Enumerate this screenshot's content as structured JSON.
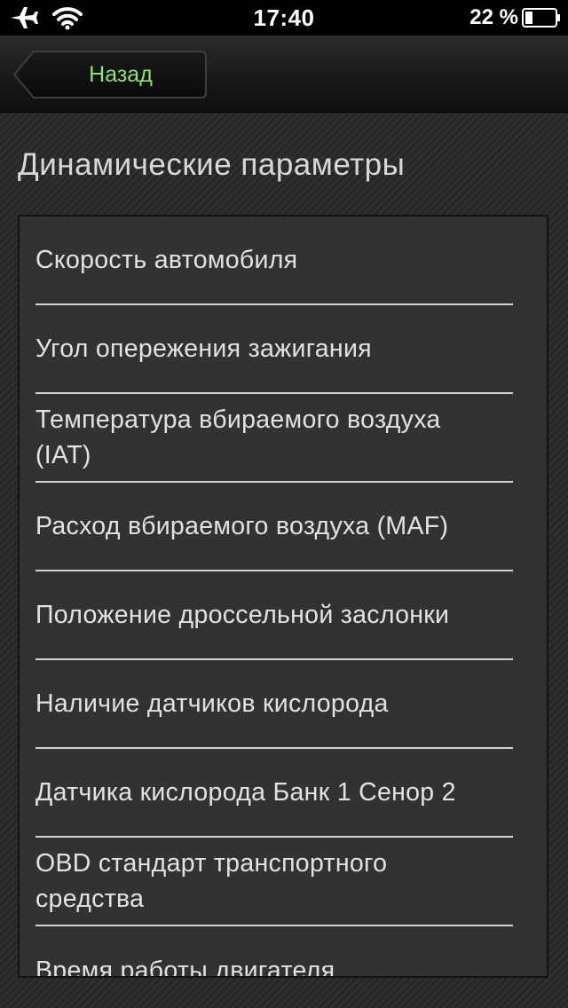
{
  "status_bar": {
    "time": "17:40",
    "battery_percent": "22 %",
    "icons": [
      "airplane-icon",
      "wifi-icon",
      "battery-icon"
    ]
  },
  "nav": {
    "back_label": "Назад"
  },
  "page": {
    "title": "Динамические параметры"
  },
  "list": {
    "items": [
      {
        "label": "Скорость автомобиля"
      },
      {
        "label": "Угол опережения зажигания"
      },
      {
        "label": "Температура вбираемого воздуха\n(IAT)"
      },
      {
        "label": "Расход вбираемого воздуха (MAF)"
      },
      {
        "label": "Положение дроссельной заслонки"
      },
      {
        "label": "Наличие датчиков кислорода"
      },
      {
        "label": "Датчика кислорода Банк 1 Сенор 2"
      },
      {
        "label": "OBD стандарт транспортного\nсредства"
      },
      {
        "label": "Время работы двигателя"
      }
    ]
  },
  "colors": {
    "accent_back_text": "#8ee27a",
    "background": "#2a2a2a",
    "panel": "#323232",
    "text": "#e2e2e2"
  }
}
